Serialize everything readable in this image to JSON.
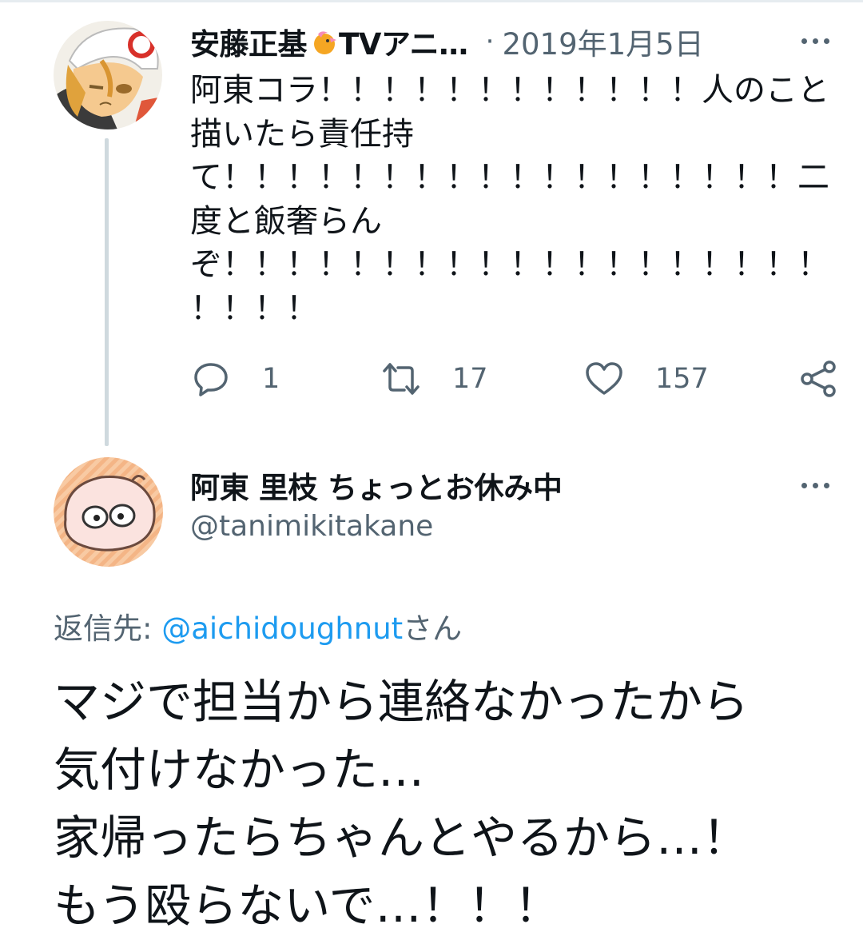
{
  "parent_tweet": {
    "display_name": "安藤正基",
    "display_name_rest": "TVアニ…",
    "separator": "·",
    "date": "2019年1月5日",
    "text_lines": [
      "阿東コラ！！！！！！！！！！！！人のこと",
      "描いたら責任持",
      "て！！！！！！！！！！！！！！！！！！二",
      "度と飯奢らん",
      "ぞ！！！！！！！！！！！！！！！！！！！",
      "！！！！"
    ],
    "reply_count": "1",
    "retweet_count": "17",
    "like_count": "157",
    "icons": {
      "avatar": "avatar-image",
      "badge": "bird-emoji-icon",
      "reply": "reply-icon",
      "retweet": "retweet-icon",
      "like": "heart-icon",
      "share": "share-icon",
      "more": "more-options-icon"
    }
  },
  "reply_tweet": {
    "display_name": "阿東 里枝 ちょっとお休み中",
    "handle": "@tanimikitakane",
    "replying_to_label": "返信先: ",
    "replying_to_mention": "@aichidoughnut",
    "replying_to_suffix": "さん",
    "text_lines": [
      "マジで担当から連絡なかったから",
      "気付けなかった…",
      "家帰ったらちゃんとやるから…！",
      "もう殴らないで…！！！"
    ]
  },
  "colors": {
    "text_primary": "#0f1419",
    "text_secondary": "#536471",
    "link": "#1d9bf0",
    "thread_line": "#cfd9de"
  }
}
